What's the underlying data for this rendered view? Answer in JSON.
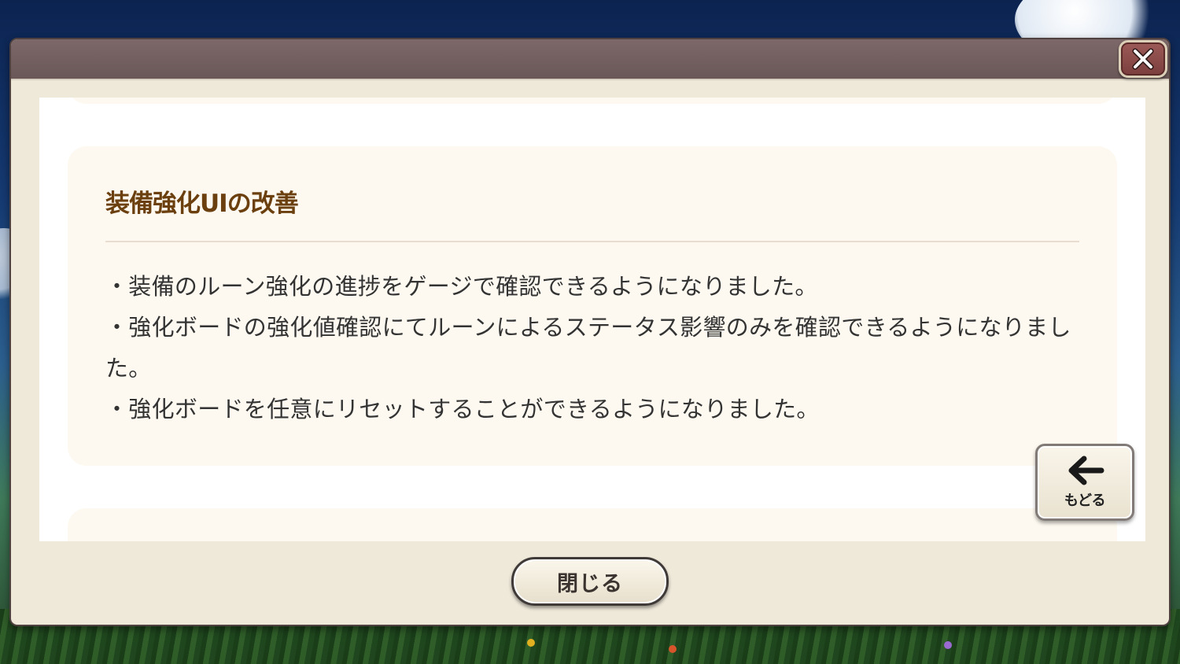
{
  "dialog": {
    "close_icon": "close-x-icon",
    "colors": {
      "header": "#6e5a5a",
      "frame": "#efe9da",
      "card": "#fdf9f0",
      "title_text": "#6b3f0e"
    }
  },
  "notice": {
    "title": "装備強化UIの改善",
    "lines": [
      "・装備のルーン強化の進捗をゲージで確認できるようになりました。",
      "・強化ボードの強化値確認にてルーンによるステータス影響のみを確認できるようになりました。",
      "・強化ボードを任意にリセットすることができるようになりました。"
    ]
  },
  "back_button": {
    "icon": "arrow-left-icon",
    "label": "もどる"
  },
  "close_button": {
    "label": "閉じる"
  }
}
